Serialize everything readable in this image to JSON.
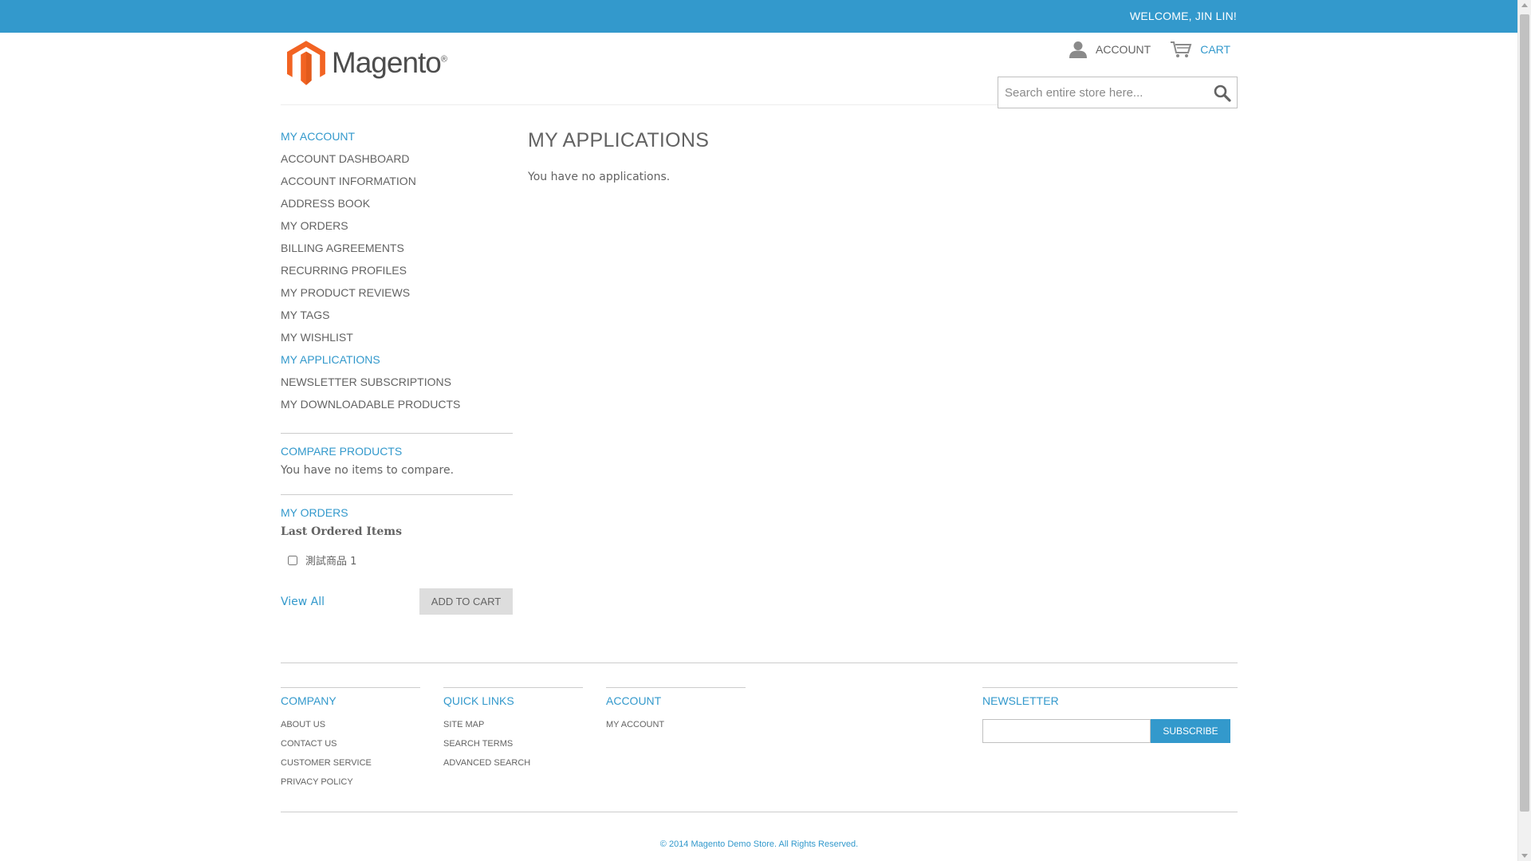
{
  "header": {
    "welcome": "WELCOME, JIN LIN!",
    "logo_text": "Magento",
    "account_label": "ACCOUNT",
    "cart_label": "CART",
    "search_placeholder": "Search entire store here..."
  },
  "sidebar": {
    "my_account_title": "MY ACCOUNT",
    "nav_items": [
      "ACCOUNT DASHBOARD",
      "ACCOUNT INFORMATION",
      "ADDRESS BOOK",
      "MY ORDERS",
      "BILLING AGREEMENTS",
      "RECURRING PROFILES",
      "MY PRODUCT REVIEWS",
      "MY TAGS",
      "MY WISHLIST",
      "MY APPLICATIONS",
      "NEWSLETTER SUBSCRIPTIONS",
      "MY DOWNLOADABLE PRODUCTS"
    ],
    "active_item": "MY APPLICATIONS",
    "compare_title": "COMPARE PRODUCTS",
    "compare_text": "You have no items to compare.",
    "orders_title": "MY ORDERS",
    "orders_subtitle": "Last Ordered Items",
    "ordered_item": "測試商品 1",
    "view_all": "View All",
    "add_to_cart": "ADD TO CART"
  },
  "main": {
    "title": "MY APPLICATIONS",
    "message": "You have no applications."
  },
  "footer": {
    "company": {
      "title": "COMPANY",
      "links": [
        "ABOUT US",
        "CONTACT US",
        "CUSTOMER SERVICE",
        "PRIVACY POLICY"
      ]
    },
    "quick_links": {
      "title": "QUICK LINKS",
      "links": [
        "SITE MAP",
        "SEARCH TERMS",
        "ADVANCED SEARCH"
      ]
    },
    "account": {
      "title": "ACCOUNT",
      "links": [
        "MY ACCOUNT"
      ]
    },
    "newsletter": {
      "title": "NEWSLETTER",
      "subscribe": "SUBSCRIBE"
    },
    "copyright": "© 2014 Magento Demo Store. All Rights Reserved."
  },
  "colors": {
    "accent": "#3399cc",
    "text": "#636363",
    "button_grey": "#dddddd",
    "logo_orange": "#f26322"
  }
}
